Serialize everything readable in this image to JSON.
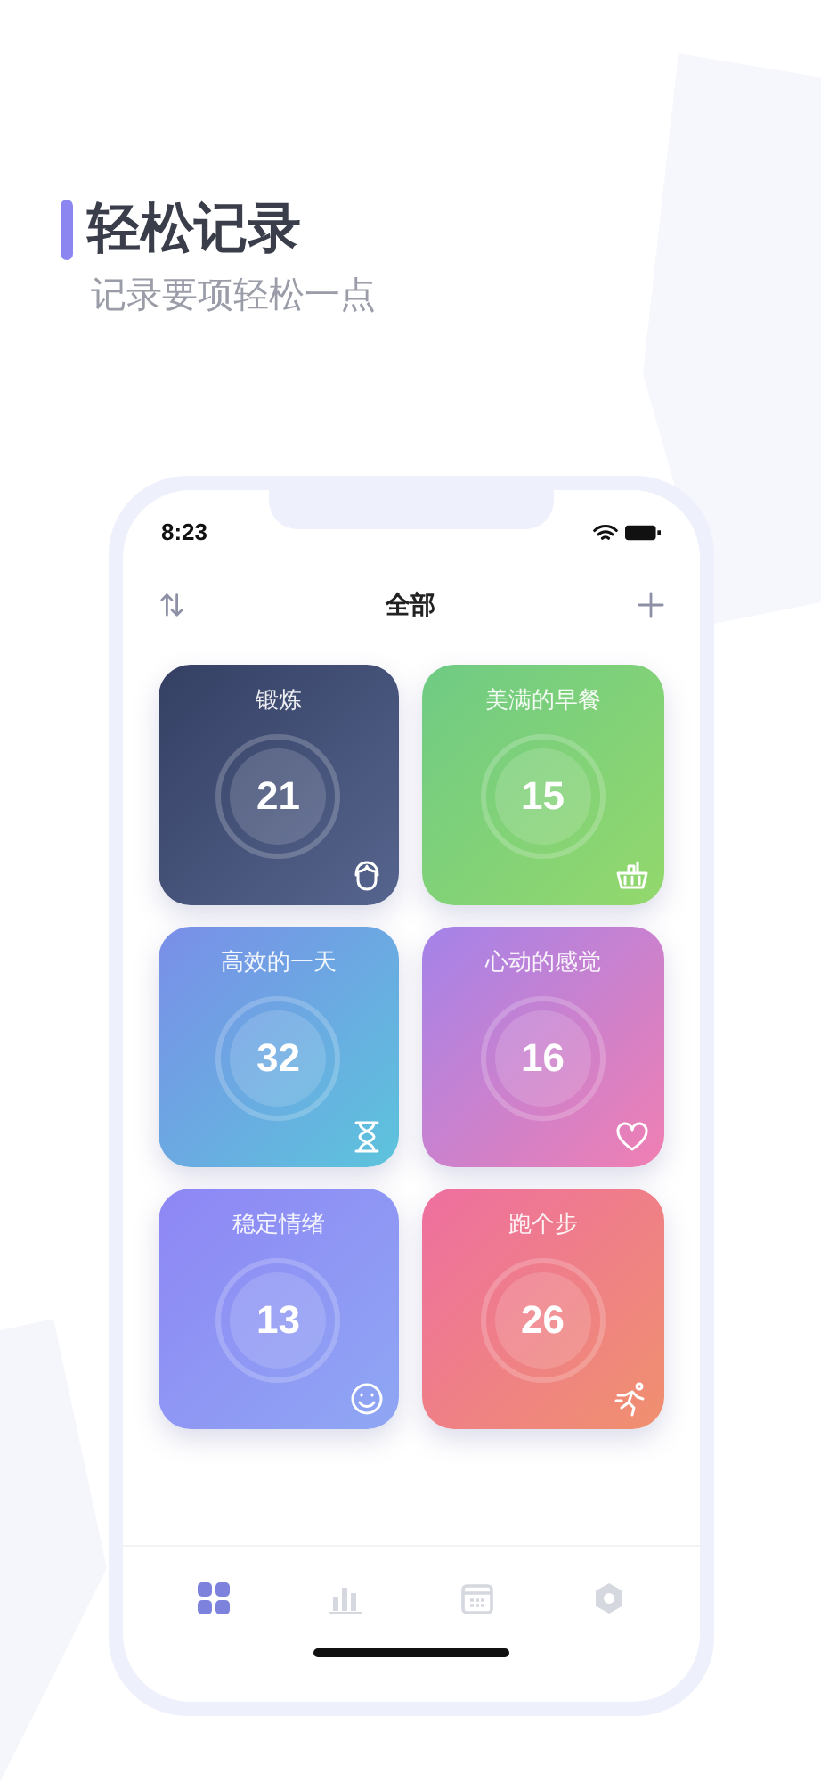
{
  "headline": {
    "title": "轻松记录",
    "subtitle": "记录要项轻松一点"
  },
  "status_bar": {
    "time": "8:23"
  },
  "header": {
    "title": "全部"
  },
  "cards": [
    {
      "title": "锻炼",
      "count": "21",
      "kind": "face",
      "color": "#343f63"
    },
    {
      "title": "美满的早餐",
      "count": "15",
      "kind": "basket",
      "color": "#6fcb84"
    },
    {
      "title": "高效的一天",
      "count": "32",
      "kind": "hourglass",
      "color": "#7a8ee8"
    },
    {
      "title": "心动的感觉",
      "count": "16",
      "kind": "heart",
      "color": "#a483ea"
    },
    {
      "title": "稳定情绪",
      "count": "13",
      "kind": "smile",
      "color": "#8e86f5"
    },
    {
      "title": "跑个步",
      "count": "26",
      "kind": "runner",
      "color": "#ee6fa0"
    }
  ],
  "tab_bar": [
    {
      "kind": "grid",
      "selected": true
    },
    {
      "kind": "chart",
      "selected": false
    },
    {
      "kind": "calendar",
      "selected": false
    },
    {
      "kind": "settings",
      "selected": false
    }
  ]
}
